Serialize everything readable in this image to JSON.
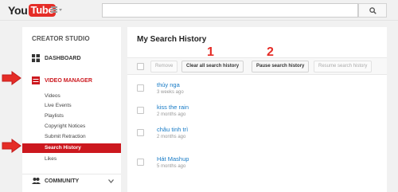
{
  "header": {
    "logo_you": "You",
    "logo_tube": "Tube",
    "search_placeholder": ""
  },
  "sidebar": {
    "title": "CREATOR STUDIO",
    "dashboard": "DASHBOARD",
    "video_manager": "VIDEO MANAGER",
    "sub_items": [
      "Videos",
      "Live Events",
      "Playlists",
      "Copyright Notices",
      "Submit Retraction",
      "Search History",
      "Likes"
    ],
    "selected_item": "Search History",
    "community": "COMMUNITY"
  },
  "main": {
    "title": "My Search History",
    "buttons": {
      "remove": "Remove",
      "clear_all": "Clear all search history",
      "pause": "Pause search history",
      "resume": "Resume search history"
    },
    "annotations": {
      "step1": "1",
      "step2": "2"
    },
    "history": [
      {
        "query": "thúy nga",
        "time": "3 weeks ago"
      },
      {
        "query": "kiss the rain",
        "time": "2 months ago"
      },
      {
        "query": "châu tinh trì",
        "time": "2 months ago"
      },
      {
        "query": "Hát Mashup",
        "time": "5 months ago"
      }
    ]
  },
  "colors": {
    "brand_red": "#cc181e",
    "link_blue": "#167ac6",
    "annotation_red": "#e52d27"
  }
}
